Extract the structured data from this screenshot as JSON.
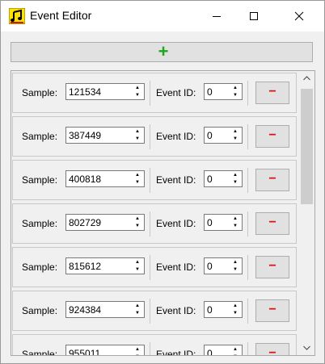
{
  "window": {
    "title": "Event Editor"
  },
  "toolbar": {
    "add_label": "+"
  },
  "labels": {
    "sample": "Sample:",
    "event_id": "Event ID:",
    "remove": "−"
  },
  "rows": [
    {
      "sample": "121534",
      "event_id": "0"
    },
    {
      "sample": "387449",
      "event_id": "0"
    },
    {
      "sample": "400818",
      "event_id": "0"
    },
    {
      "sample": "802729",
      "event_id": "0"
    },
    {
      "sample": "815612",
      "event_id": "0"
    },
    {
      "sample": "924384",
      "event_id": "0"
    },
    {
      "sample": "955011",
      "event_id": "0"
    }
  ],
  "colors": {
    "add": "#1fa51f",
    "remove": "#e01010",
    "icon_bg": "#ffe000"
  },
  "icons": {
    "app": "music-note-icon",
    "scroll_up": "chevron-up-icon",
    "scroll_down": "chevron-down-icon"
  }
}
